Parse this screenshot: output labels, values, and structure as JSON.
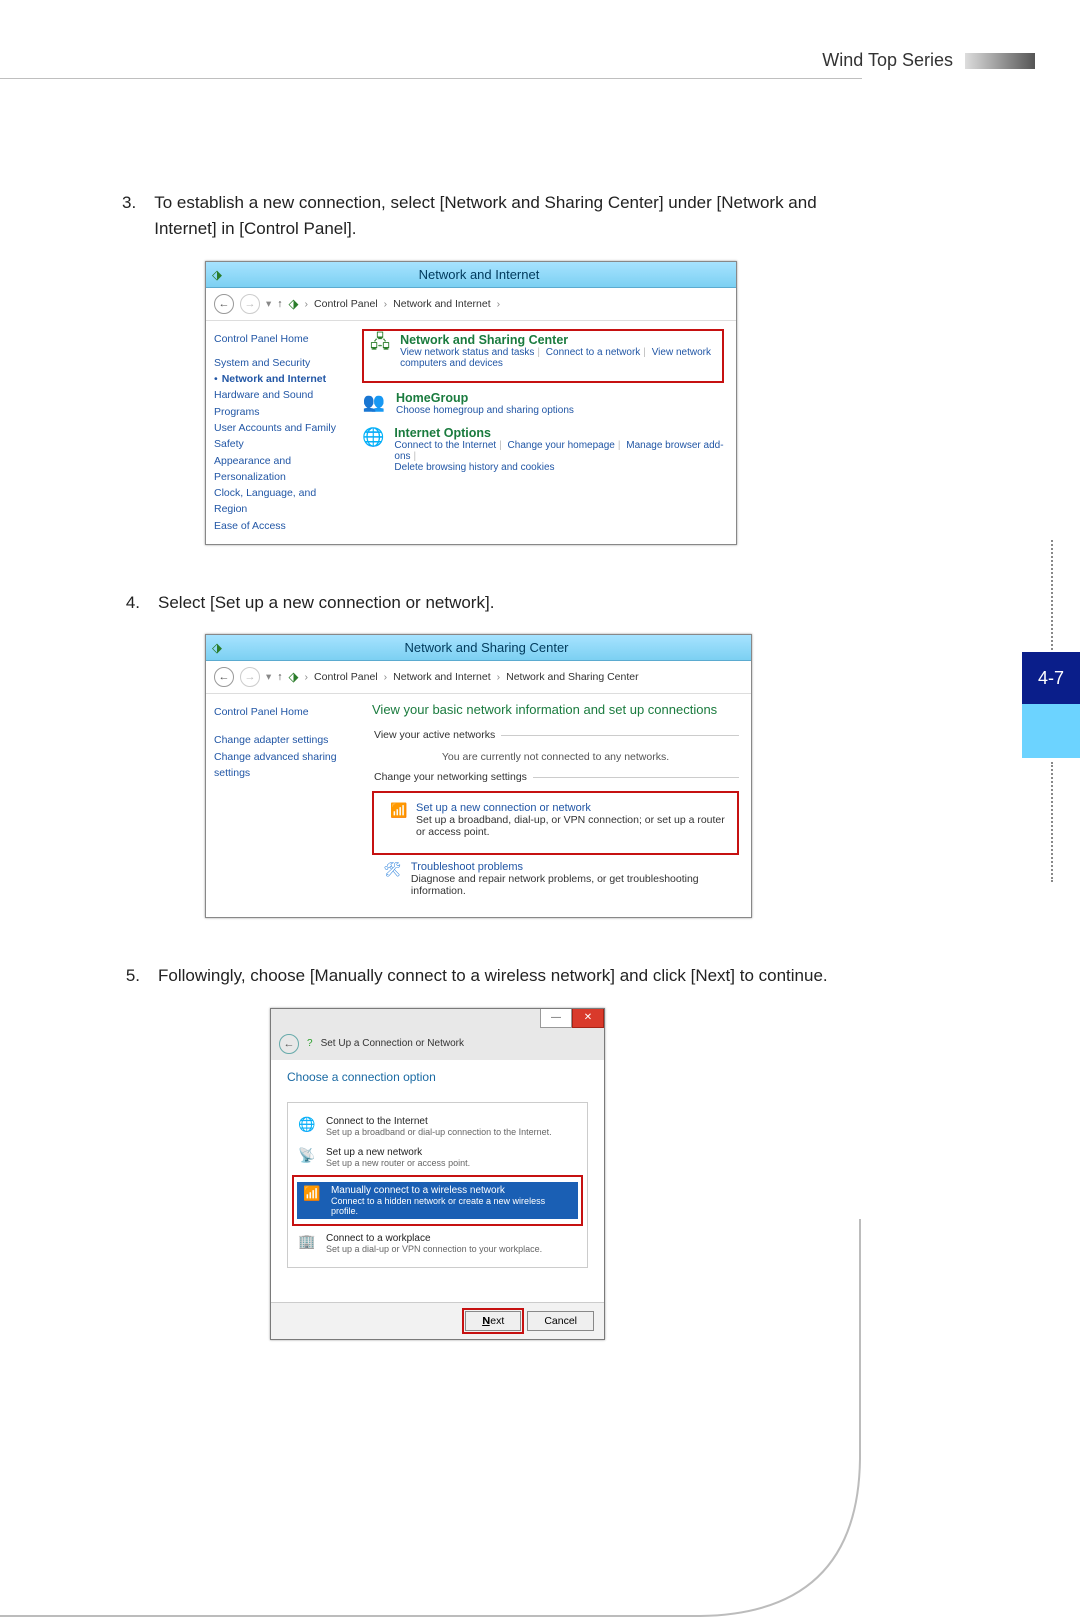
{
  "header": {
    "series": "Wind Top Series",
    "page_num": "4-7"
  },
  "steps": {
    "s3_num": "3.",
    "s3": "To establish a new connection, select [Network and Sharing Center] under [Network and Internet] in [Control Panel].",
    "s4_num": "4.",
    "s4": "Select [Set up a new connection or network].",
    "s5_num": "5.",
    "s5": "Followingly, choose [Manually connect to a wireless network] and click [Next] to continue."
  },
  "fig1": {
    "title": "Network and Internet",
    "crumb_cp": "Control Panel",
    "crumb_ni": "Network and Internet",
    "side": {
      "home": "Control Panel Home",
      "ss": "System and Security",
      "ni": "Network and Internet",
      "hs": "Hardware and Sound",
      "pg": "Programs",
      "ua": "User Accounts and Family Safety",
      "ap": "Appearance and Personalization",
      "cl": "Clock, Language, and Region",
      "ea": "Ease of Access"
    },
    "nsc": {
      "title": "Network and Sharing Center",
      "l1": "View network status and tasks",
      "l2": "Connect to a network",
      "l3": "View network computers and devices"
    },
    "hg": {
      "title": "HomeGroup",
      "l1": "Choose homegroup and sharing options"
    },
    "io": {
      "title": "Internet Options",
      "l1": "Connect to the Internet",
      "l2": "Change your homepage",
      "l3": "Manage browser add-ons",
      "l4": "Delete browsing history and cookies"
    }
  },
  "fig2": {
    "title": "Network and Sharing Center",
    "crumb_cp": "Control Panel",
    "crumb_ni": "Network and Internet",
    "crumb_nsc": "Network and Sharing Center",
    "side": {
      "home": "Control Panel Home",
      "cas": "Change adapter settings",
      "cass": "Change advanced sharing settings"
    },
    "h1": "View your basic network information and set up connections",
    "fs1": "View your active networks",
    "none": "You are currently not connected to any networks.",
    "fs2": "Change your networking settings",
    "t1a": "Set up a new connection or network",
    "t1b": "Set up a broadband, dial-up, or VPN connection; or set up a router or access point.",
    "t2a": "Troubleshoot problems",
    "t2b": "Diagnose and repair network problems, or get troubleshooting information."
  },
  "fig3": {
    "back_glyph": "←",
    "head": "Set Up a Connection or Network",
    "h1": "Choose a connection option",
    "o1a": "Connect to the Internet",
    "o1b": "Set up a broadband or dial-up connection to the Internet.",
    "o2a": "Set up a new network",
    "o2b": "Set up a new router or access point.",
    "o3a": "Manually connect to a wireless network",
    "o3b": "Connect to a hidden network or create a new wireless profile.",
    "o4a": "Connect to a workplace",
    "o4b": "Set up a dial-up or VPN connection to your workplace.",
    "next": "Next",
    "cancel": "Cancel"
  }
}
